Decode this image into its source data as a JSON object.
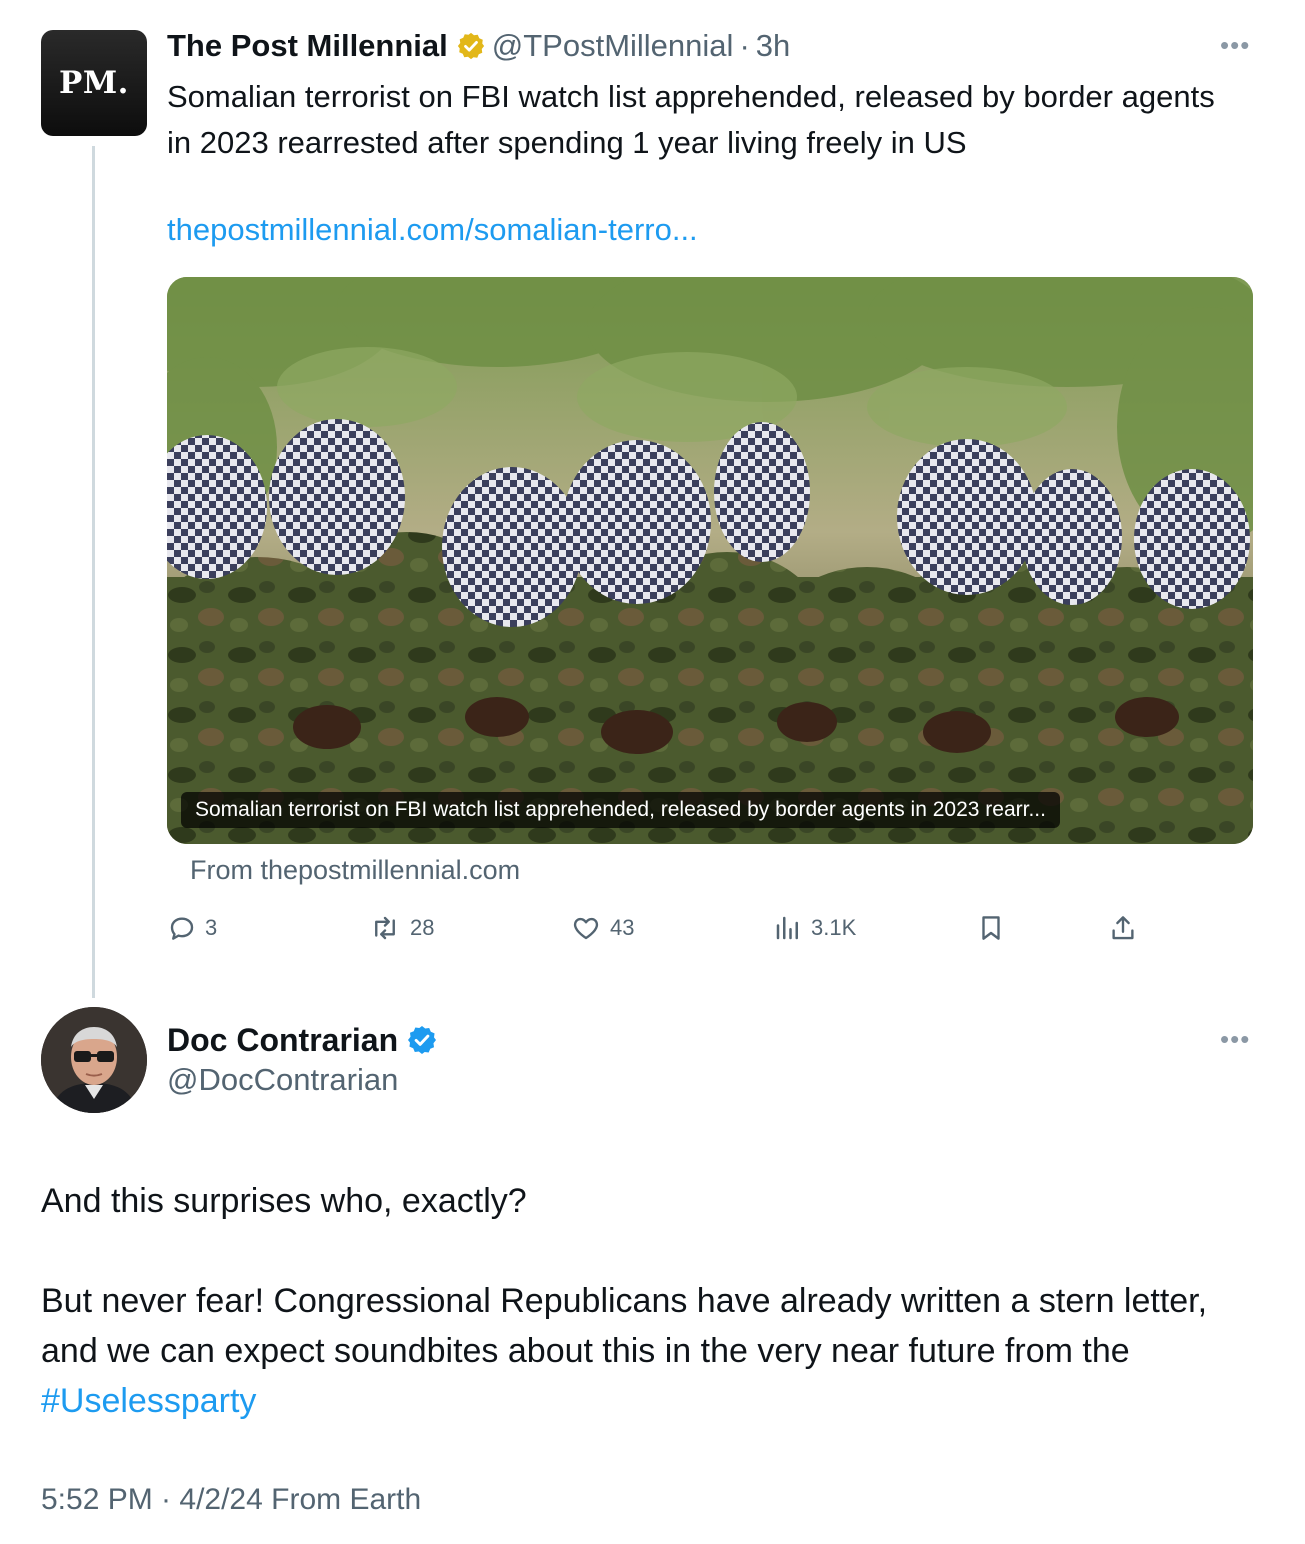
{
  "quoted_tweet": {
    "avatar_text": "PM.",
    "display_name": "The Post Millennial",
    "handle": "@TPostMillennial",
    "separator": "·",
    "time_ago": "3h",
    "more_icon": "ellipsis-icon",
    "text": "Somalian terrorist on FBI watch list apprehended, released by border agents in 2023 rearrested after spending 1 year living freely in US",
    "link": "thepostmillennial.com/somalian-terro...",
    "card": {
      "caption": "Somalian terrorist on FBI watch list apprehended, released by border agents in 2023 rearr...",
      "from": "From thepostmillennial.com"
    },
    "actions": {
      "replies": "3",
      "reposts": "28",
      "likes": "43",
      "views": "3.1K"
    },
    "badge_color": "#e2b719"
  },
  "main_tweet": {
    "display_name": "Doc Contrarian",
    "handle": "@DocContrarian",
    "more_icon": "ellipsis-icon",
    "paragraph_1": "And this surprises who, exactly?",
    "paragraph_2": "But never fear! Congressional Republicans have already written a stern letter, and we can expect soundbites about this in the very near future from the ",
    "hashtag": "#Uselessparty",
    "timestamp": "5:52 PM · 4/2/24 From Earth",
    "badge_color": "#1d9bf0"
  },
  "colors": {
    "link": "#1d9bf0",
    "secondary_text": "#536471",
    "thread_line": "#cfd9de"
  }
}
